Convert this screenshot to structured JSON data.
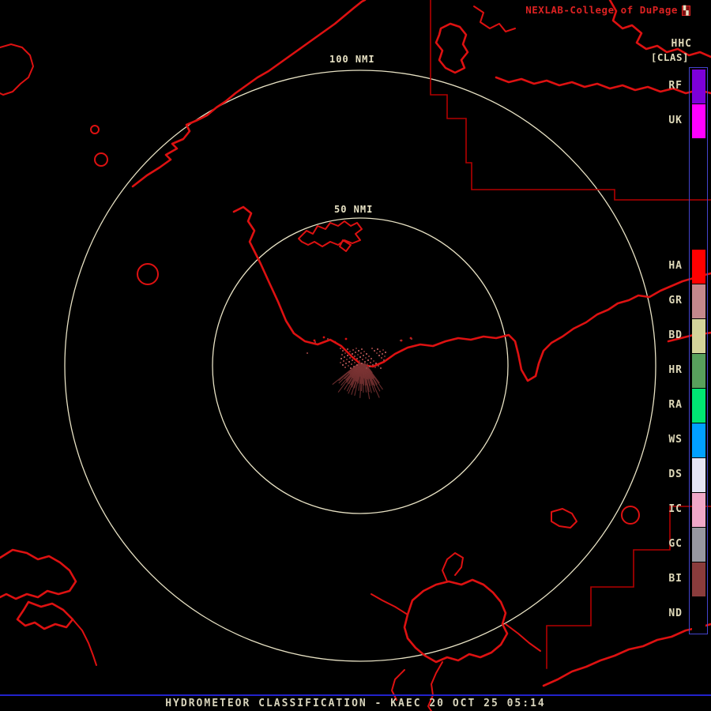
{
  "header": {
    "brand": "NEXLAB-College of DuPage",
    "logo_glyph": "▚",
    "product_code": "HHC",
    "product_tag": "[CLAS]"
  },
  "rings": {
    "outer_label": "100 NMI",
    "inner_label": "50 NMI"
  },
  "legend": {
    "items": [
      {
        "label": "RF",
        "color": "#7d00d9"
      },
      {
        "label": "UK",
        "color": "#ff00ff"
      },
      {
        "label": "HA",
        "color": "#ff0000"
      },
      {
        "label": "GR",
        "color": "#c4888c"
      },
      {
        "label": "BD",
        "color": "#d4d49a"
      },
      {
        "label": "HR",
        "color": "#58a05c"
      },
      {
        "label": "RA",
        "color": "#00e673"
      },
      {
        "label": "WS",
        "color": "#00a0ff"
      },
      {
        "label": "DS",
        "color": "#e4e4f4"
      },
      {
        "label": "IC",
        "color": "#f0a8c8"
      },
      {
        "label": "GC",
        "color": "#9898a0"
      },
      {
        "label": "BI",
        "color": "#8a3c3c"
      },
      {
        "label": "ND",
        "color": "#000000"
      }
    ]
  },
  "footer": {
    "title": "HYDROMETEOR CLASSIFICATION - KAEC 20 OCT 25 05:14"
  },
  "colors": {
    "background": "#000000",
    "map_outline": "#dd1111",
    "boundary_line": "#b30000",
    "range_ring": "#e8e2c4",
    "brand_text": "#dd2222",
    "cream_text": "#ded8b8",
    "legend_border": "#4343cc",
    "footer_rule": "#2222cc",
    "footer_text": "#d8d4bc",
    "echo_primary": "#7c3434"
  }
}
